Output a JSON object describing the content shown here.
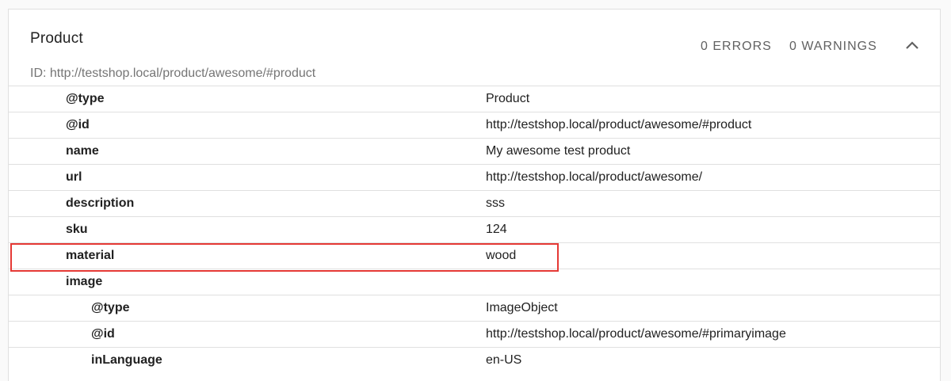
{
  "entity": {
    "title": "Product",
    "errors_label": "0 ERRORS",
    "warnings_label": "0 WARNINGS",
    "id_text": "ID: http://testshop.local/product/awesome/#product"
  },
  "rows": [
    {
      "key": "@type",
      "value": "Product"
    },
    {
      "key": "@id",
      "value": "http://testshop.local/product/awesome/#product"
    },
    {
      "key": "name",
      "value": "My awesome test product"
    },
    {
      "key": "url",
      "value": "http://testshop.local/product/awesome/"
    },
    {
      "key": "description",
      "value": "sss"
    },
    {
      "key": "sku",
      "value": "124"
    },
    {
      "key": "material",
      "value": "wood"
    },
    {
      "key": "image",
      "value": ""
    },
    {
      "key": "@type",
      "value": "ImageObject"
    },
    {
      "key": "@id",
      "value": "http://testshop.local/product/awesome/#primaryimage"
    },
    {
      "key": "inLanguage",
      "value": "en-US"
    }
  ],
  "colors": {
    "highlight": "#e53935",
    "divider": "#e0e0e0"
  },
  "icons": {
    "collapse": "chevron-up-icon"
  }
}
